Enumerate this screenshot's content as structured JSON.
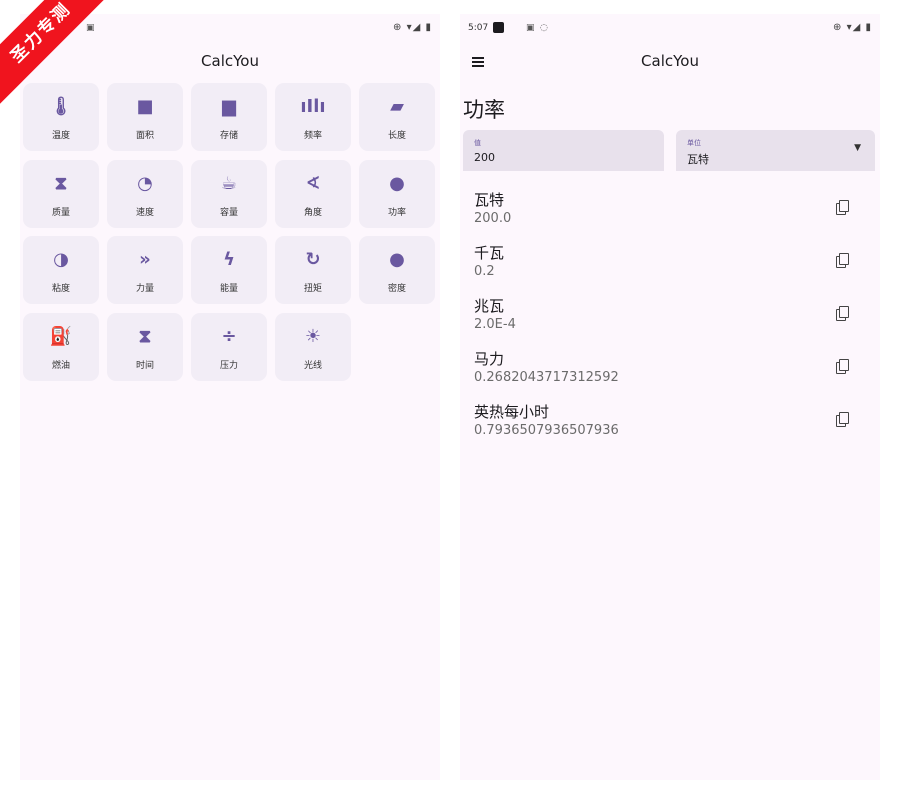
{
  "colors": {
    "accent": "#6a58a0",
    "surface": "#fdf7fd",
    "tile": "#f2edf6",
    "field": "#e8e1ec",
    "watermark": "#f0141e"
  },
  "watermark": "圣力专测",
  "left_screen": {
    "status_right": "⊕ ▾◢ ▮",
    "app_title": "CalcYou",
    "categories": [
      {
        "icon": "thermometer-icon",
        "glyph": "🌡",
        "label": "温度"
      },
      {
        "icon": "square-icon",
        "glyph": "■",
        "label": "面积"
      },
      {
        "icon": "sd-card-icon",
        "glyph": "▆",
        "label": "存储"
      },
      {
        "icon": "waveform-icon",
        "glyph": "ıIlı",
        "label": "频率"
      },
      {
        "icon": "ruler-icon",
        "glyph": "▰",
        "label": "长度"
      },
      {
        "icon": "scale-icon",
        "glyph": "⧗",
        "label": "质量"
      },
      {
        "icon": "speedometer-icon",
        "glyph": "◔",
        "label": "速度"
      },
      {
        "icon": "cup-icon",
        "glyph": "☕",
        "label": "容量"
      },
      {
        "icon": "angle-icon",
        "glyph": "∢",
        "label": "角度"
      },
      {
        "icon": "lightbulb-icon",
        "glyph": "●",
        "label": "功率"
      },
      {
        "icon": "contrast-icon",
        "glyph": "◑",
        "label": "粘度"
      },
      {
        "icon": "double-chevron-icon",
        "glyph": "»",
        "label": "力量"
      },
      {
        "icon": "bolt-icon",
        "glyph": "ϟ",
        "label": "能量"
      },
      {
        "icon": "rotate-icon",
        "glyph": "↻",
        "label": "扭矩"
      },
      {
        "icon": "drop-icon",
        "glyph": "●",
        "label": "密度"
      },
      {
        "icon": "fuel-pump-icon",
        "glyph": "⛽",
        "label": "燃油"
      },
      {
        "icon": "hourglass-icon",
        "glyph": "⧗",
        "label": "时间"
      },
      {
        "icon": "compress-icon",
        "glyph": "÷",
        "label": "压力"
      },
      {
        "icon": "sun-icon",
        "glyph": "☀",
        "label": "光线"
      }
    ]
  },
  "right_screen": {
    "status_time": "5:07",
    "status_right": "⊕ ▾◢ ▮",
    "app_title": "CalcYou",
    "page_title": "功率",
    "value_field": {
      "label": "值",
      "value": "200"
    },
    "unit_field": {
      "label": "单位",
      "value": "瓦特"
    },
    "results": [
      {
        "name": "瓦特",
        "value": "200.0"
      },
      {
        "name": "千瓦",
        "value": "0.2"
      },
      {
        "name": "兆瓦",
        "value": "2.0E-4"
      },
      {
        "name": "马力",
        "value": "0.2682043717312592"
      },
      {
        "name": "英热每小时",
        "value": "0.7936507936507936"
      }
    ]
  }
}
